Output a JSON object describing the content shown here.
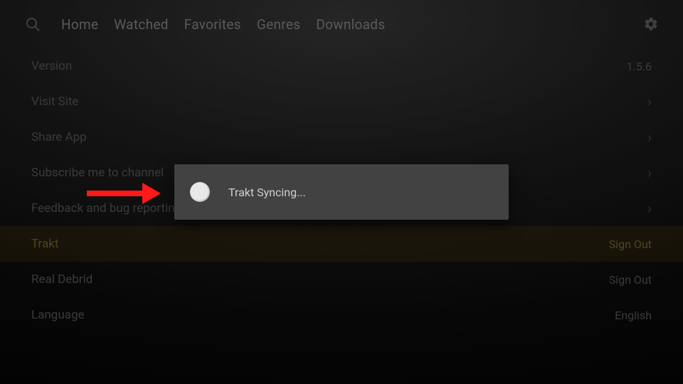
{
  "nav": {
    "items": [
      "Home",
      "Watched",
      "Favorites",
      "Genres",
      "Downloads"
    ]
  },
  "settings": [
    {
      "label": "Version",
      "value": "1.5.6",
      "chevron": false,
      "highlight": false
    },
    {
      "label": "Visit Site",
      "value": "",
      "chevron": true,
      "highlight": false
    },
    {
      "label": "Share App",
      "value": "",
      "chevron": true,
      "highlight": false
    },
    {
      "label": "Subscribe me to channel",
      "value": "",
      "chevron": true,
      "highlight": false
    },
    {
      "label": "Feedback and bug reporting",
      "value": "",
      "chevron": true,
      "highlight": false
    },
    {
      "label": "Trakt",
      "value": "Sign Out",
      "chevron": false,
      "highlight": true
    },
    {
      "label": "Real Debrid",
      "value": "Sign Out",
      "chevron": false,
      "highlight": false
    },
    {
      "label": "Language",
      "value": "English",
      "chevron": false,
      "highlight": false
    }
  ],
  "dialog": {
    "message": "Trakt Syncing..."
  }
}
